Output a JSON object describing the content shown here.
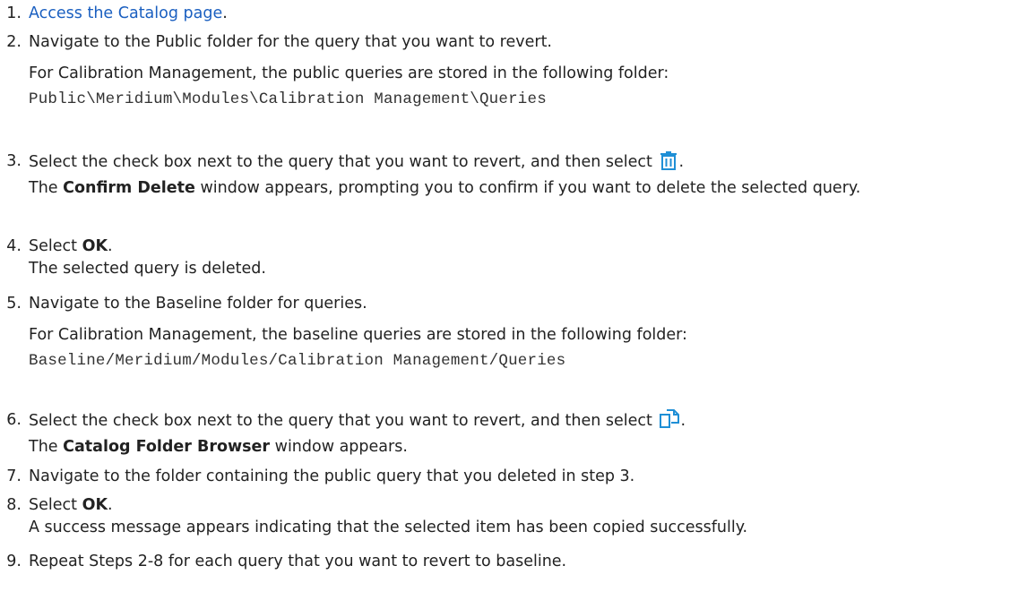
{
  "steps": [
    {
      "num": "1.",
      "link": "Access the Catalog page",
      "after_link": "."
    },
    {
      "num": "2.",
      "text": "Navigate to the Public folder for the query that you want to revert.",
      "note": "For Calibration Management, the public queries are stored in the following folder:",
      "path": "Public\\Meridium\\Modules\\Calibration Management\\Queries"
    },
    {
      "num": "3.",
      "text": "Select the check box next to the query that you want to revert, and then select",
      "end": ".",
      "icon": "trash-icon",
      "result_pre": "The ",
      "result_bold": "Confirm Delete",
      "result_post": " window appears, prompting you to confirm if you want to delete the selected query."
    },
    {
      "num": "4.",
      "pre": "Select ",
      "bold": "OK",
      "end": ".",
      "result": "The selected query is deleted."
    },
    {
      "num": "5.",
      "text": "Navigate to the Baseline folder for queries.",
      "note": "For Calibration Management, the baseline queries are stored in the following folder:",
      "path": "Baseline/Meridium/Modules/Calibration Management/Queries"
    },
    {
      "num": "6.",
      "text": "Select the check box next to the query that you want to revert, and then select",
      "end": ".",
      "icon": "copy-icon",
      "result_pre": "The ",
      "result_bold": "Catalog Folder Browser",
      "result_post": " window appears."
    },
    {
      "num": "7.",
      "text": "Navigate to the folder containing the public query that you deleted in step 3."
    },
    {
      "num": "8.",
      "pre": "Select ",
      "bold": "OK",
      "end": ".",
      "result": "A success message appears indicating that the selected item has been copied successfully."
    },
    {
      "num": "9.",
      "text": "Repeat Steps 2-8 for each query that you want to revert to baseline."
    }
  ],
  "colors": {
    "link": "#1a5fc0",
    "icon": "#1f8fd6",
    "text": "#222222"
  }
}
